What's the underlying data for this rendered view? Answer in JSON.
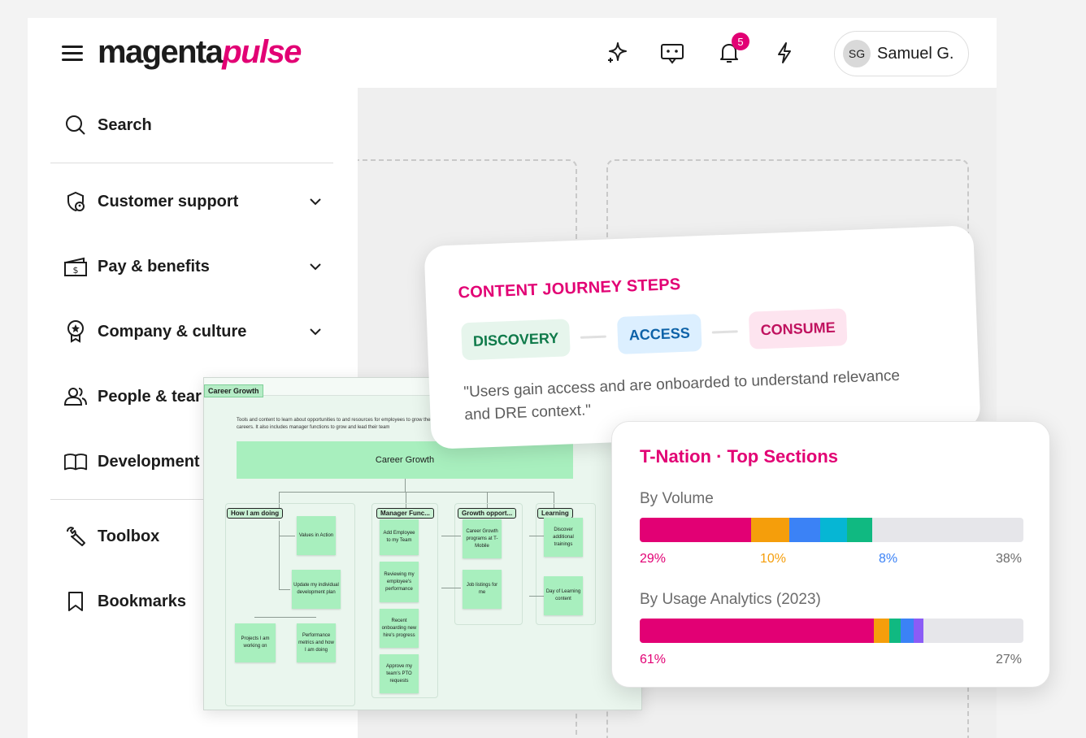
{
  "header": {
    "logo_main": "magenta",
    "logo_accent": "pulse",
    "notification_count": "5",
    "user": {
      "initials": "SG",
      "name": "Samuel G."
    }
  },
  "sidebar": {
    "search_label": "Search",
    "items": [
      {
        "label": "Customer support",
        "icon": "shield-user-icon",
        "expandable": true
      },
      {
        "label": "Pay & benefits",
        "icon": "wallet-icon",
        "expandable": true
      },
      {
        "label": "Company & culture",
        "icon": "award-icon",
        "expandable": true
      },
      {
        "label": "People & tear",
        "icon": "people-icon",
        "expandable": false
      },
      {
        "label": "Development",
        "icon": "book-icon",
        "expandable": false
      }
    ],
    "tools": [
      {
        "label": "Toolbox",
        "icon": "wrench-icon"
      },
      {
        "label": "Bookmarks",
        "icon": "bookmark-icon"
      }
    ]
  },
  "board": {
    "tag": "Career Growth",
    "description": "Tools and content to learn about opportunities to and resources for employees to grow their careers. It also includes manager functions to grow and lead their team",
    "main": "Career Growth",
    "lanes": [
      {
        "header": "How I am doing",
        "stickies": [
          "Values in Action",
          "Update my individual development plan",
          "Projects I am working on",
          "Performance metrics and how I am doing"
        ]
      },
      {
        "header": "Manager Func...",
        "stickies": [
          "Add Employee to my Team",
          "Reviewing my employee's performance",
          "Recent onboarding new hire's progress",
          "Approve my team's PTO requests"
        ]
      },
      {
        "header": "Growth opport...",
        "stickies": [
          "Career Growth programs at T-Mobile",
          "Job listings for me"
        ]
      },
      {
        "header": "Learning",
        "stickies": [
          "Discover additional trainings",
          "Day of Learning content"
        ]
      }
    ]
  },
  "journey": {
    "title": "CONTENT JOURNEY STEPS",
    "steps": [
      "DISCOVERY",
      "ACCESS",
      "CONSUME"
    ],
    "quote": "\"Users gain access and are onboarded to understand relevance and DRE context.\""
  },
  "sections": {
    "title": "T-Nation · Top Sections",
    "volume": {
      "label": "By Volume",
      "segments": [
        {
          "value": 29,
          "color": "#e20074"
        },
        {
          "value": 10,
          "color": "#f59e0b"
        },
        {
          "value": 8,
          "color": "#3b82f6"
        },
        {
          "value": 7,
          "color": "#06b6d4"
        },
        {
          "value": 6.5,
          "color": "#10b981"
        }
      ],
      "labels": [
        "29%",
        "10%",
        "8%",
        "38%"
      ]
    },
    "usage": {
      "label": "By Usage Analytics (2023)",
      "segments": [
        {
          "value": 61,
          "color": "#e20074"
        },
        {
          "value": 4,
          "color": "#f59e0b"
        },
        {
          "value": 3,
          "color": "#10b981"
        },
        {
          "value": 3.5,
          "color": "#3b82f6"
        },
        {
          "value": 2.5,
          "color": "#8b5cf6"
        }
      ],
      "labels": [
        "61%",
        "27%"
      ]
    }
  }
}
